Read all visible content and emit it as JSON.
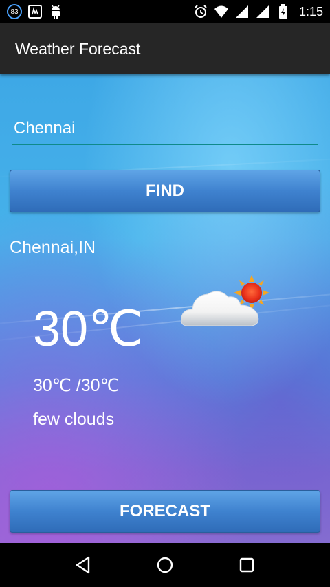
{
  "status_bar": {
    "notification_count": "83",
    "time": "1:15",
    "icons": [
      "notification-badge",
      "screenshot-icon",
      "android-icon",
      "alarm-icon",
      "wifi-icon",
      "signal-icon",
      "signal-icon",
      "battery-icon"
    ]
  },
  "app_bar": {
    "title": "Weather Forecast"
  },
  "search": {
    "value": "Chennai",
    "placeholder": ""
  },
  "buttons": {
    "find_label": "FIND",
    "forecast_label": "FORECAST"
  },
  "weather": {
    "location": "Chennai,IN",
    "temperature": "30℃",
    "range": "30℃ /30℃",
    "description": "few clouds",
    "icon": "partly-cloudy-icon"
  },
  "nav_bar": {
    "icons": [
      "back-icon",
      "home-icon",
      "recents-icon"
    ]
  },
  "colors": {
    "app_bar": "#262626",
    "input_underline": "#0f8a8a",
    "button": "#3f82cf"
  }
}
